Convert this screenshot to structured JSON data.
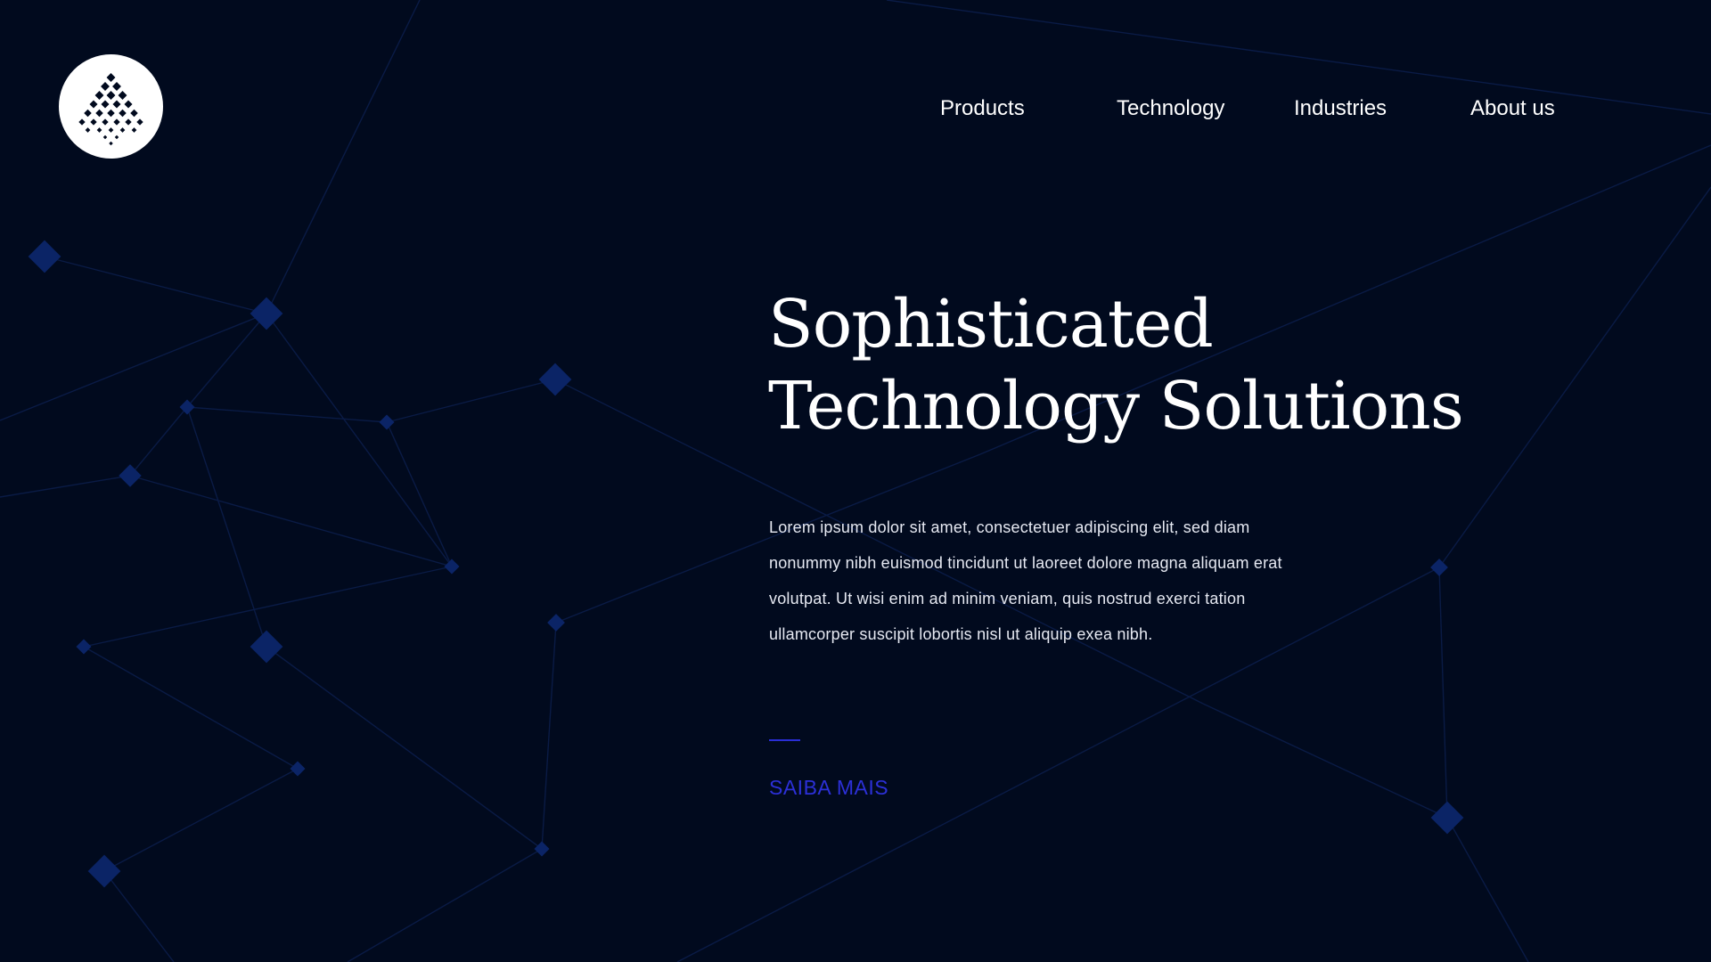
{
  "brand": {
    "logo_icon": "dot-triangle-logo-icon"
  },
  "nav": {
    "items": [
      {
        "label": "Products"
      },
      {
        "label": "Technology"
      },
      {
        "label": "Industries"
      },
      {
        "label": "About us"
      }
    ]
  },
  "hero": {
    "title_line1": "Sophisticated",
    "title_line2": "Technology Solutions",
    "body": "Lorem ipsum dolor sit amet, consectetuer adipiscing elit, sed diam nonummy nibh euismod tincidunt ut laoreet dolore magna aliquam erat volutpat. Ut wisi enim ad minim veniam, quis nostrud exerci tation ullamcorper suscipit lobortis nisl ut aliquip exea nibh.",
    "cta_label": "SAIBA MAIS"
  },
  "colors": {
    "background": "#010a1e",
    "accent": "#2c30d8",
    "network_node": "#0b2466",
    "network_line": "#0a1b45",
    "text": "#ffffff"
  }
}
